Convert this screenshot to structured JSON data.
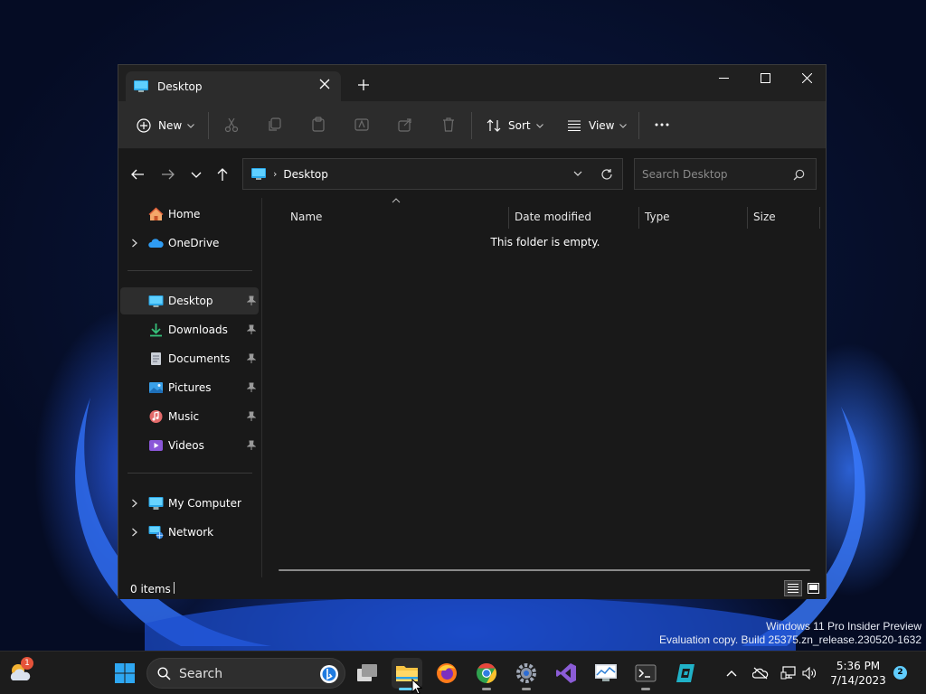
{
  "watermark": {
    "line1": "Windows 11 Pro Insider Preview",
    "line2": "Evaluation copy. Build 25375.zn_release.230520-1632"
  },
  "window": {
    "tab_title": "Desktop",
    "toolbar": {
      "new_label": "New",
      "sort_label": "Sort",
      "view_label": "View"
    },
    "address": {
      "crumb": "Desktop"
    },
    "search": {
      "placeholder": "Search Desktop"
    },
    "sidebar": {
      "items": [
        {
          "label": "Home",
          "icon": "home-icon"
        },
        {
          "label": "OneDrive",
          "icon": "onedrive-icon"
        },
        {
          "label": "Desktop",
          "icon": "desktop-folder-icon",
          "selected": true
        },
        {
          "label": "Downloads",
          "icon": "downloads-icon"
        },
        {
          "label": "Documents",
          "icon": "documents-icon"
        },
        {
          "label": "Pictures",
          "icon": "pictures-icon"
        },
        {
          "label": "Music",
          "icon": "music-icon"
        },
        {
          "label": "Videos",
          "icon": "videos-icon"
        },
        {
          "label": "My Computer",
          "icon": "computer-icon"
        },
        {
          "label": "Network",
          "icon": "network-icon"
        }
      ]
    },
    "columns": [
      "Name",
      "Date modified",
      "Type",
      "Size"
    ],
    "empty_message": "This folder is empty.",
    "status": "0 items"
  },
  "taskbar": {
    "search_placeholder": "Search",
    "weather_badge": "1",
    "time": "5:36 PM",
    "date": "7/14/2023",
    "notifications": "2",
    "apps": [
      "start-icon",
      "task-view-icon",
      "file-explorer-icon",
      "firefox-icon",
      "chrome-icon",
      "settings-icon",
      "visual-studio-icon",
      "resource-monitor-icon",
      "terminal-icon",
      "app-icon"
    ]
  },
  "colors": {
    "accent": "#60cdff",
    "window_bg": "#191919",
    "toolbar_bg": "#2c2c2c"
  }
}
